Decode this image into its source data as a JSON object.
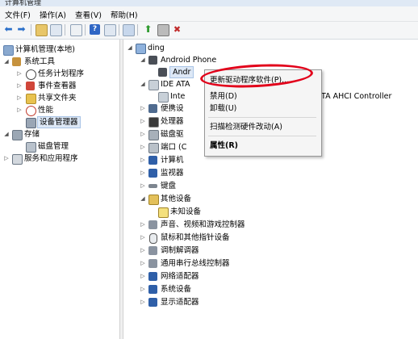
{
  "window": {
    "title": "计算机管理"
  },
  "menu": [
    "文件(F)",
    "操作(A)",
    "查看(V)",
    "帮助(H)"
  ],
  "left_tree": [
    {
      "label": "计算机管理(本地)",
      "icon": "computer-management-icon"
    },
    {
      "label": "系统工具",
      "icon": "tools-icon"
    },
    {
      "label": "任务计划程序",
      "icon": "clock-icon"
    },
    {
      "label": "事件查看器",
      "icon": "event-viewer-icon"
    },
    {
      "label": "共享文件夹",
      "icon": "shared-folder-icon"
    },
    {
      "label": "性能",
      "icon": "performance-icon"
    },
    {
      "label": "设备管理器",
      "icon": "device-manager-icon"
    },
    {
      "label": "存储",
      "icon": "storage-icon"
    },
    {
      "label": "磁盘管理",
      "icon": "disk-icon"
    },
    {
      "label": "服务和应用程序",
      "icon": "services-icon"
    }
  ],
  "right_tree": [
    {
      "label": "ding",
      "icon": "computer-icon"
    },
    {
      "label": "Android Phone",
      "icon": "phone-icon"
    },
    {
      "label": "Andr",
      "icon": "phone-device-icon"
    },
    {
      "label": "IDE ATA",
      "icon": "ide-icon"
    },
    {
      "label": "Inte",
      "icon": "ide-device-icon"
    },
    {
      "label": "TA AHCI Controller",
      "icon": ""
    },
    {
      "label": "便携设",
      "icon": "portable-icon"
    },
    {
      "label": "处理器",
      "icon": "cpu-icon"
    },
    {
      "label": "磁盘驱",
      "icon": "disk-drive-icon"
    },
    {
      "label": "端口 (C",
      "icon": "port-icon"
    },
    {
      "label": "计算机",
      "icon": "computer-icon"
    },
    {
      "label": "监视器",
      "icon": "monitor-icon"
    },
    {
      "label": "键盘",
      "icon": "keyboard-icon"
    },
    {
      "label": "其他设备",
      "icon": "other-devices-icon"
    },
    {
      "label": "未知设备",
      "icon": "unknown-device-icon"
    },
    {
      "label": "声音、视频和游戏控制器",
      "icon": "sound-icon"
    },
    {
      "label": "鼠标和其他指针设备",
      "icon": "mouse-icon"
    },
    {
      "label": "调制解调器",
      "icon": "modem-icon"
    },
    {
      "label": "通用串行总线控制器",
      "icon": "usb-icon"
    },
    {
      "label": "网络适配器",
      "icon": "network-icon"
    },
    {
      "label": "系统设备",
      "icon": "system-device-icon"
    },
    {
      "label": "显示适配器",
      "icon": "display-adapter-icon"
    }
  ],
  "context_menu": [
    "更新驱动程序软件(P)...",
    "禁用(D)",
    "卸载(U)",
    "扫描检测硬件改动(A)",
    "属性(R)"
  ],
  "colors": {
    "highlight_ellipse": "#e2001a",
    "menu_bg": "#f5f5f5",
    "selection": "#dde8f6"
  }
}
